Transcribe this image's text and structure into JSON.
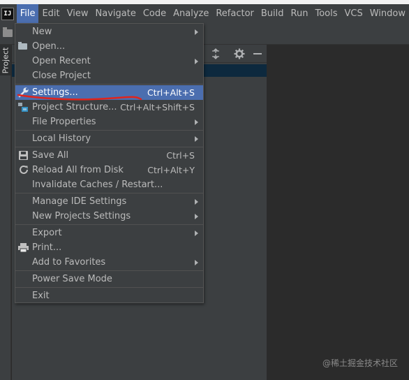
{
  "menubar": {
    "logo_text": "IJ",
    "items": [
      {
        "label": "File",
        "active": true
      },
      {
        "label": "Edit"
      },
      {
        "label": "View"
      },
      {
        "label": "Navigate"
      },
      {
        "label": "Code"
      },
      {
        "label": "Analyze"
      },
      {
        "label": "Refactor"
      },
      {
        "label": "Build"
      },
      {
        "label": "Run"
      },
      {
        "label": "Tools"
      },
      {
        "label": "VCS"
      },
      {
        "label": "Window"
      }
    ]
  },
  "left_strip": {
    "project_label": "Project"
  },
  "file_menu": {
    "items": [
      {
        "label": "New",
        "submenu": true,
        "icon": "none"
      },
      {
        "label": "Open...",
        "icon": "folder-icon"
      },
      {
        "label": "Open Recent",
        "submenu": true
      },
      {
        "label": "Close Project"
      },
      {
        "label": "Settings...",
        "shortcut": "Ctrl+Alt+S",
        "icon": "wrench-icon",
        "selected": true
      },
      {
        "label": "Project Structure...",
        "shortcut": "Ctrl+Alt+Shift+S",
        "icon": "project-structure-icon"
      },
      {
        "label": "File Properties",
        "submenu": true
      },
      {
        "label": "Local History",
        "submenu": true
      },
      {
        "label": "Save All",
        "shortcut": "Ctrl+S",
        "icon": "save-icon"
      },
      {
        "label": "Reload All from Disk",
        "shortcut": "Ctrl+Alt+Y",
        "icon": "reload-icon"
      },
      {
        "label": "Invalidate Caches / Restart..."
      },
      {
        "label": "Manage IDE Settings",
        "submenu": true
      },
      {
        "label": "New Projects Settings",
        "submenu": true
      },
      {
        "label": "Export",
        "submenu": true
      },
      {
        "label": "Print...",
        "icon": "print-icon"
      },
      {
        "label": "Add to Favorites",
        "submenu": true
      },
      {
        "label": "Power Save Mode"
      },
      {
        "label": "Exit"
      }
    ]
  },
  "watermark": "@稀土掘金技术社区",
  "colors": {
    "menubar_bg": "#3c3f41",
    "editor_bg": "#2b2b2b",
    "selection": "#4b6eaf",
    "annotation": "#e0241c"
  }
}
